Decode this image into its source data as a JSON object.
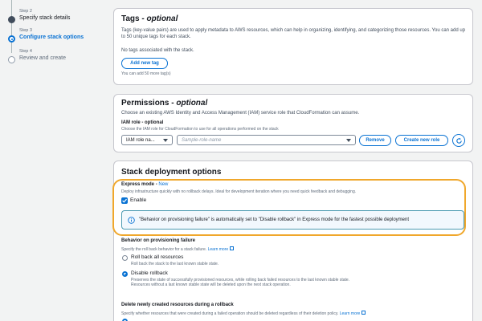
{
  "steps": [
    {
      "num": "Step 2",
      "name": "Specify stack details"
    },
    {
      "num": "Step 3",
      "name": "Configure stack options"
    },
    {
      "num": "Step 4",
      "name": "Review and create"
    }
  ],
  "tags": {
    "title": "Tags",
    "title_suffix": "optional",
    "desc": "Tags (key-value pairs) are used to apply metadata to AWS resources, which can help in organizing, identifying, and categorizing those resources. You can add up to 50 unique tags for each stack.",
    "empty": "No tags associated with the stack.",
    "add_button": "Add new tag",
    "hint": "You can add 50 more tag(s)"
  },
  "permissions": {
    "title": "Permissions",
    "title_suffix": "optional",
    "desc": "Choose an existing AWS Identity and Access Management (IAM) service role that CloudFormation can assume.",
    "role_label": "IAM role - optional",
    "role_desc": "Choose the IAM role for CloudFormation to use for all operations performed on the stack",
    "select_value": "IAM role na...",
    "role_placeholder": "Sample-role-name",
    "remove_button": "Remove",
    "create_button": "Create new role"
  },
  "deployment": {
    "title": "Stack deployment options",
    "express_label": "Express mode",
    "express_badge": "New",
    "express_desc": "Deploy infrastructure quickly with no rollback delays. Ideal for development iteration where you need quick feedback and debugging.",
    "enable_label": "Enable",
    "enable_checked": true,
    "info": "\"Behavior on provisioning failure\" is automatically set to \"Disable rollback\" in Express mode for the fastest possible deployment",
    "behavior_label": "Behavior on provisioning failure",
    "behavior_desc": "Specify the roll back behavior for a stack failure.",
    "learn_more": "Learn more",
    "option1_label": "Roll back all resources",
    "option1_desc": "Roll back the stack to the last known stable state.",
    "option2_label": "Disable rollback",
    "option2_desc": "Preserves the state of successfully provisioned resources, while rolling back failed resources to the last known stable state. Resources without a last known stable state will be deleted upon the next stack operation.",
    "selected_option": "Disable rollback",
    "delete_label": "Delete newly created resources during a rollback",
    "delete_desc": "Specify whether resources that were created during a failed operation should be deleted regardless of their deletion policy.",
    "delete_learn_more": "Learn more"
  },
  "colors": {
    "accent": "#0972d3",
    "highlight": "#f0a72b",
    "info_bg": "#f2f8fd"
  }
}
